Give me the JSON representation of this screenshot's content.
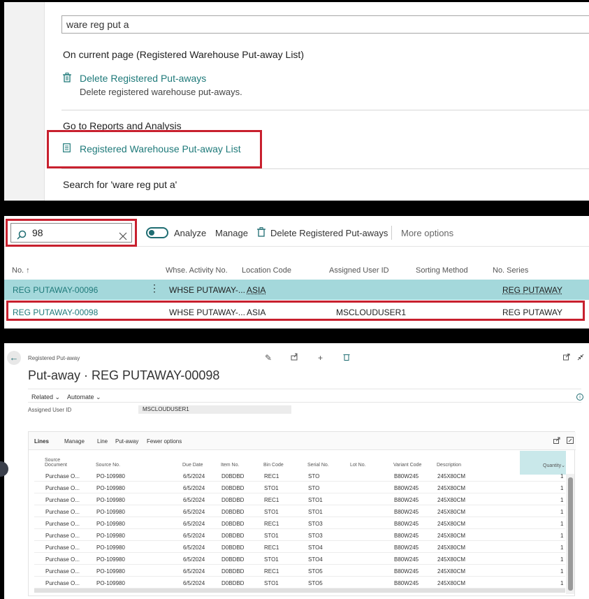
{
  "search_popup": {
    "query": "ware reg put a",
    "section_current_page": "On current page (Registered Warehouse Put-away List)",
    "delete_link": "Delete Registered Put-aways",
    "delete_desc": "Delete registered warehouse put-aways.",
    "section_reports": "Go to Reports and Analysis",
    "report_link": "Registered Warehouse Put-away List",
    "search_for": "Search for 'ware reg put a'"
  },
  "list_page": {
    "search_value": "98",
    "toolbar": {
      "analyze": "Analyze",
      "manage": "Manage",
      "delete": "Delete Registered Put-aways",
      "more": "More options"
    },
    "columns": [
      "No. ↑",
      "Whse. Activity No.",
      "Location Code",
      "Assigned User ID",
      "Sorting Method",
      "No. Series"
    ],
    "rows": [
      {
        "no": "REG PUTAWAY-00096",
        "activity": "WHSE PUTAWAY-...",
        "location": "ASIA",
        "user": "",
        "sorting": "",
        "series": "REG PUTAWAY"
      },
      {
        "no": "REG PUTAWAY-00098",
        "activity": "WHSE PUTAWAY-...",
        "location": "ASIA",
        "user": "MSCLOUDUSER1",
        "sorting": "",
        "series": "REG PUTAWAY"
      }
    ]
  },
  "card_page": {
    "breadcrumb": "Registered Put-away",
    "title": "Put-away · REG PUTAWAY-00098",
    "actions": {
      "related": "Related",
      "automate": "Automate"
    },
    "assigned_user_label": "Assigned User ID",
    "assigned_user_value": "MSCLOUDUSER1",
    "lines_bar": {
      "lines": "Lines",
      "manage": "Manage",
      "line": "Line",
      "putaway": "Put-away",
      "fewer": "Fewer options"
    },
    "grid_headers": {
      "source_document_1": "Source",
      "source_document_2": "Document",
      "source_no": "Source No.",
      "due_date": "Due Date",
      "item_no": "Item No.",
      "bin_code": "Bin Code",
      "serial_no": "Serial No.",
      "lot_no": "Lot No.",
      "variant_code": "Variant Code",
      "description": "Description",
      "quantity": "Quantity"
    },
    "grid_rows": [
      {
        "doc": "Purchase O...",
        "src": "PO-109980",
        "due": "6/5/2024",
        "item": "D0BDBD",
        "bin": "REC1",
        "serial": "STO",
        "lot": "",
        "variant": "B80W245",
        "desc": "245X80CM",
        "qty": "1"
      },
      {
        "doc": "Purchase O...",
        "src": "PO-109980",
        "due": "6/5/2024",
        "item": "D0BDBD",
        "bin": "STO1",
        "serial": "STO",
        "lot": "",
        "variant": "B80W245",
        "desc": "245X80CM",
        "qty": "1"
      },
      {
        "doc": "Purchase O...",
        "src": "PO-109980",
        "due": "6/5/2024",
        "item": "D0BDBD",
        "bin": "REC1",
        "serial": "STO1",
        "lot": "",
        "variant": "B80W245",
        "desc": "245X80CM",
        "qty": "1"
      },
      {
        "doc": "Purchase O...",
        "src": "PO-109980",
        "due": "6/5/2024",
        "item": "D0BDBD",
        "bin": "STO1",
        "serial": "STO1",
        "lot": "",
        "variant": "B80W245",
        "desc": "245X80CM",
        "qty": "1"
      },
      {
        "doc": "Purchase O...",
        "src": "PO-109980",
        "due": "6/5/2024",
        "item": "D0BDBD",
        "bin": "REC1",
        "serial": "STO3",
        "lot": "",
        "variant": "B80W245",
        "desc": "245X80CM",
        "qty": "1"
      },
      {
        "doc": "Purchase O...",
        "src": "PO-109980",
        "due": "6/5/2024",
        "item": "D0BDBD",
        "bin": "STO1",
        "serial": "STO3",
        "lot": "",
        "variant": "B80W245",
        "desc": "245X80CM",
        "qty": "1"
      },
      {
        "doc": "Purchase O...",
        "src": "PO-109980",
        "due": "6/5/2024",
        "item": "D0BDBD",
        "bin": "REC1",
        "serial": "STO4",
        "lot": "",
        "variant": "B80W245",
        "desc": "245X80CM",
        "qty": "1"
      },
      {
        "doc": "Purchase O...",
        "src": "PO-109980",
        "due": "6/5/2024",
        "item": "D0BDBD",
        "bin": "STO1",
        "serial": "STO4",
        "lot": "",
        "variant": "B80W245",
        "desc": "245X80CM",
        "qty": "1"
      },
      {
        "doc": "Purchase O...",
        "src": "PO-109980",
        "due": "6/5/2024",
        "item": "D0BDBD",
        "bin": "REC1",
        "serial": "STO5",
        "lot": "",
        "variant": "B80W245",
        "desc": "245X80CM",
        "qty": "1"
      },
      {
        "doc": "Purchase O...",
        "src": "PO-109980",
        "due": "6/5/2024",
        "item": "D0BDBD",
        "bin": "STO1",
        "serial": "STO5",
        "lot": "",
        "variant": "B80W245",
        "desc": "245X80CM",
        "qty": "1"
      }
    ]
  },
  "colors": {
    "accent": "#1f7a7a",
    "highlight_border": "#c8202e",
    "selected_row": "#a4d8db"
  }
}
